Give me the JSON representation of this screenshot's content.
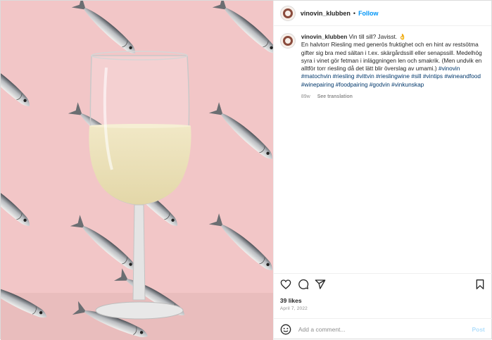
{
  "post": {
    "account": {
      "username": "vinovin_klubben",
      "follow_label": "Follow",
      "separator": "•"
    },
    "caption": {
      "username": "vinovin_klubben",
      "headline": "Vin till sill? Javisst. 👌",
      "body": "En halvtorr Riesling med generös fruktighet och en hint av restsötma gifter sig bra med sältan i t.ex. skärgårdssill eller senapssill. Medelhög syra i vinet gör fetman i inläggningen len och smakrik. (Men undvik en alltför torr riesling då det lätt blir överslag av umami.)",
      "hashtags": [
        "#vinovin",
        "#matochvin",
        "#riesling",
        "#vittvin",
        "#rieslingwine",
        "#sill",
        "#vintips",
        "#wineandfood",
        "#winepairing",
        "#foodpairing",
        "#godvin",
        "#vinkunskap"
      ],
      "age": "89w",
      "translate_label": "See translation"
    },
    "actions": {
      "like_icon": "heart-icon",
      "comment_icon": "comment-icon",
      "share_icon": "share-icon",
      "save_icon": "bookmark-icon"
    },
    "likes": "39 likes",
    "date": "April 7, 2022",
    "comment": {
      "emoji_icon": "emoji-icon",
      "placeholder": "Add a comment...",
      "value": "",
      "post_label": "Post"
    }
  },
  "colors": {
    "background_pink": "#f2c6c7",
    "link_blue": "#0095f6",
    "hashtag_blue": "#00376b",
    "post_disabled": "#b2dffc",
    "wine": "#ece1b8"
  }
}
